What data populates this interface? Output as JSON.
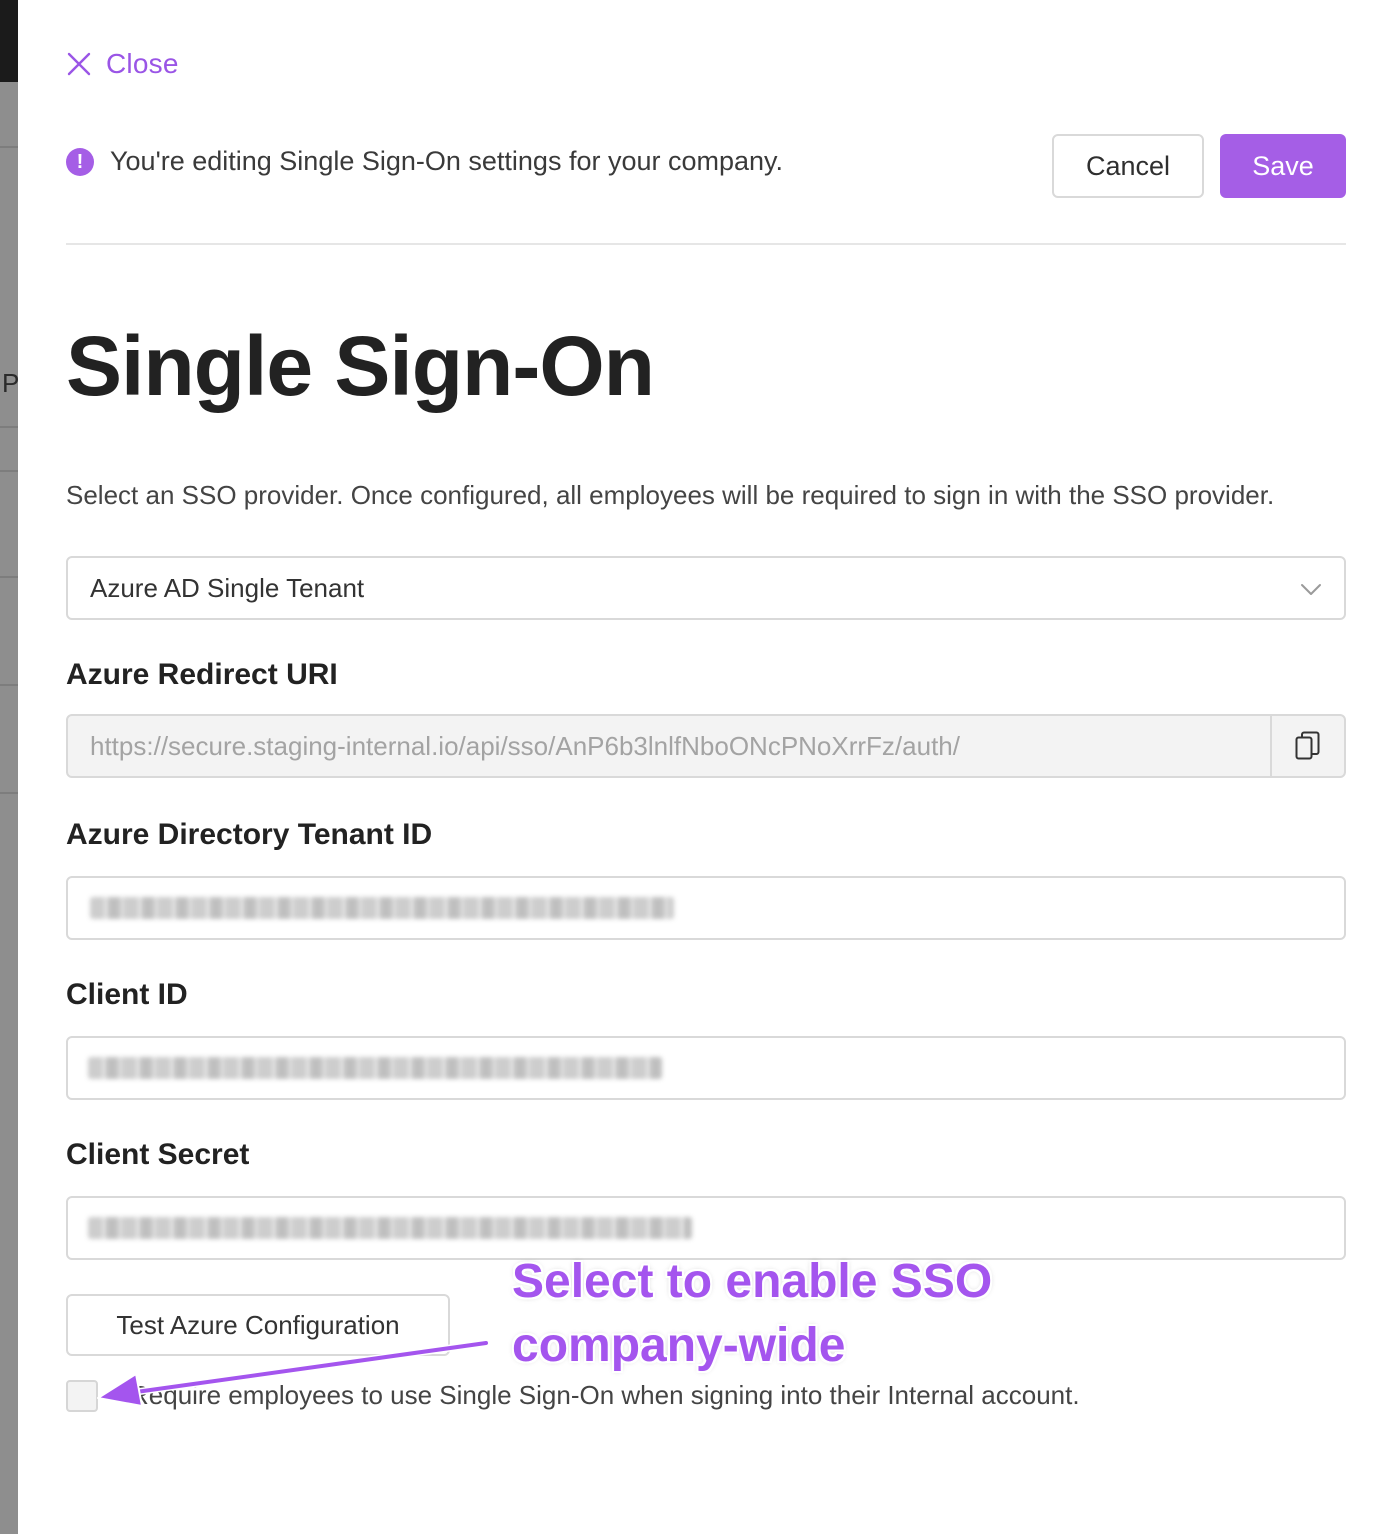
{
  "drawer": {
    "close_label": "Close",
    "notice_text": "You're editing Single Sign-On settings for your company.",
    "cancel_label": "Cancel",
    "save_label": "Save"
  },
  "sso": {
    "title": "Single Sign-On",
    "description": "Select an SSO provider. Once configured, all employees will be required to sign in with the SSO provider.",
    "provider_selected": "Azure AD Single Tenant",
    "fields": {
      "redirect_uri_label": "Azure Redirect URI",
      "redirect_uri_value": "https://secure.staging-internal.io/api/sso/AnP6b3lnlfNboONcPNoXrrFz/auth/",
      "tenant_id_label": "Azure Directory Tenant ID",
      "client_id_label": "Client ID",
      "client_secret_label": "Client Secret"
    },
    "test_button_label": "Test Azure Configuration",
    "require_checkbox_label": "Require employees to use Single Sign-On when signing into their Internal account.",
    "require_checked": false
  },
  "annotation": {
    "text_line1": "Select to enable SSO",
    "text_line2": "company-wide"
  },
  "colors": {
    "accent": "#a55ee6",
    "annotation": "#a455ee"
  },
  "icons": {
    "close": "close-icon",
    "alert": "alert-icon",
    "chevron": "chevron-down-icon",
    "copy": "copy-icon"
  },
  "background_page": {
    "partial_letter": "P"
  }
}
